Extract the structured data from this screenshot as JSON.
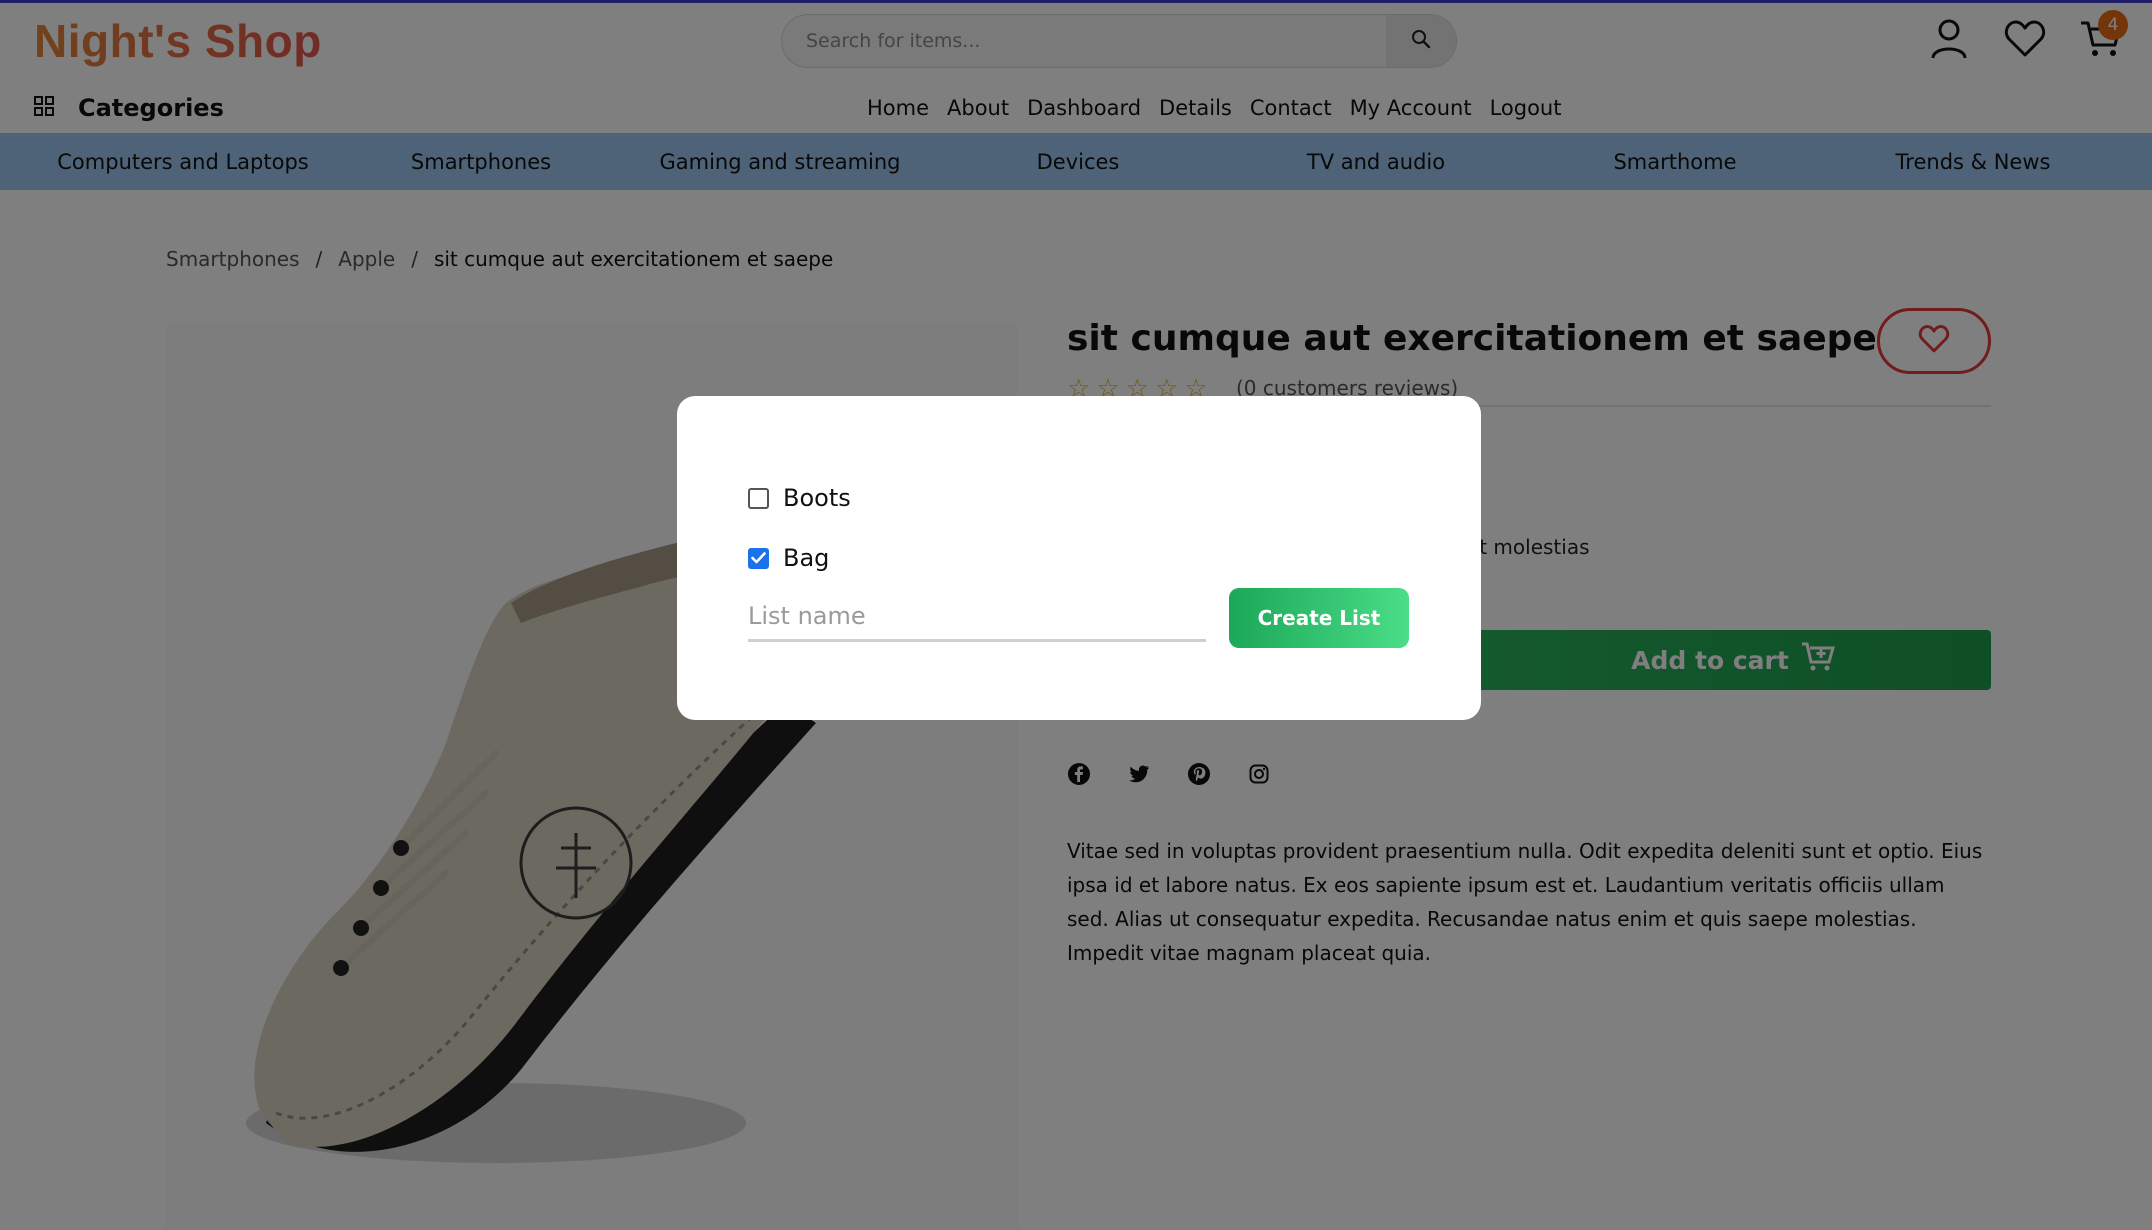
{
  "header": {
    "logo": "Night's Shop",
    "search_placeholder": "Search for items...",
    "cart_count": "4"
  },
  "categories_label": "Categories",
  "top_nav": [
    "Home",
    "About",
    "Dashboard",
    "Details",
    "Contact",
    "My Account",
    "Logout"
  ],
  "category_bar": [
    "Computers and Laptops",
    "Smartphones",
    "Gaming and streaming",
    "Devices",
    "TV and audio",
    "Smarthome",
    "Trends & News"
  ],
  "breadcrumb": {
    "items": [
      "Smartphones",
      "Apple"
    ],
    "separator": "/",
    "current": "sit cumque aut exercitationem et saepe"
  },
  "product": {
    "title": "sit cumque aut exercitationem et saepe",
    "rating_stars": 0,
    "reviews_text": "(0 customers reviews)",
    "short_description": "et voluptatem. Tenetur ipsum non sunt sit molestias",
    "add_to_cart_label": "Add to cart",
    "description": "Vitae sed in voluptas provident praesentium nulla. Odit expedita deleniti sunt et optio. Eius ipsa id et labore natus. Ex eos sapiente ipsum est et. Laudantium veritatis officiis ullam sed. Alias ut consequatur expedita. Recusandae natus enim et quis saepe molestias. Impedit vitae magnam placeat quia."
  },
  "modal": {
    "lists": [
      {
        "label": "Boots",
        "checked": false
      },
      {
        "label": "Bag",
        "checked": true
      }
    ],
    "list_name_placeholder": "List name",
    "create_label": "Create List"
  },
  "colors": {
    "category_bar": "#9dc7f0",
    "accent_green": "#1ba858",
    "heart_red": "#e53b3b",
    "badge": "#e86a12"
  },
  "icons": [
    "grid-icon",
    "search-icon",
    "user-icon",
    "heart-icon",
    "cart-icon",
    "facebook-icon",
    "twitter-icon",
    "pinterest-icon",
    "instagram-icon"
  ]
}
